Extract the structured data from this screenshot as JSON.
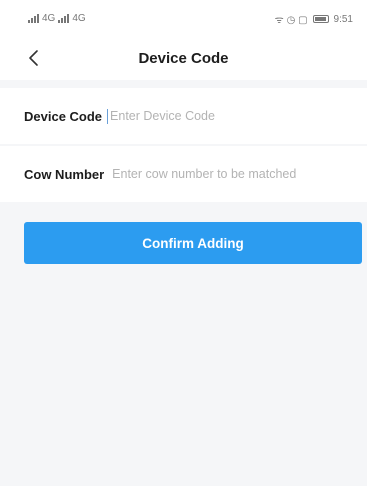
{
  "status_bar": {
    "left_text_1": "4G",
    "left_text_2": "4G",
    "right_icons": "ᯤ ◷ ▢",
    "battery_icon": "battery-icon",
    "time": "9:51"
  },
  "nav": {
    "back_icon": "chevron-left-icon",
    "title": "Device Code"
  },
  "form": {
    "device_code": {
      "label": "Device Code",
      "value": "",
      "placeholder": "Enter Device Code"
    },
    "cow_number": {
      "label": "Cow Number",
      "value": "",
      "placeholder": "Enter cow number to be matched"
    }
  },
  "actions": {
    "confirm_label": "Confirm Adding"
  },
  "colors": {
    "accent": "#2c9cf0",
    "background": "#f5f6f8",
    "surface": "#ffffff"
  }
}
